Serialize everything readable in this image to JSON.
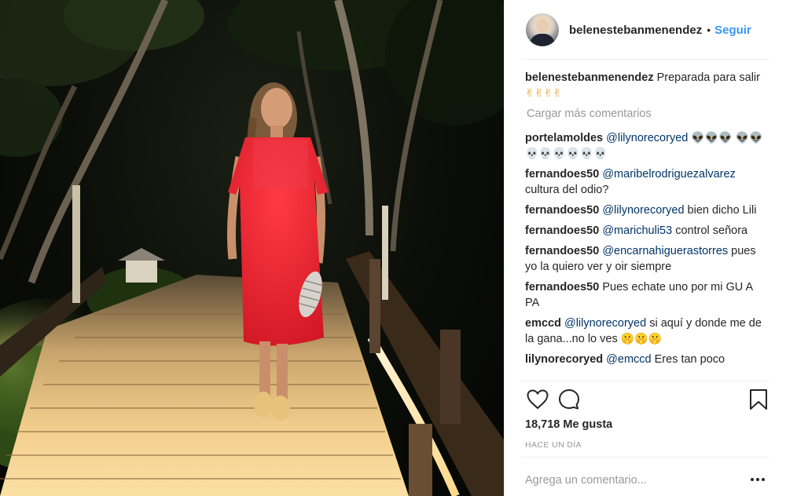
{
  "post": {
    "author": "belenestebanmenendez",
    "separator": "•",
    "follow_label": "Seguir",
    "photo_alt": "Mujer con vestido rojo sobre una pasarela de madera iluminada de noche"
  },
  "caption": {
    "user": "belenestebanmenendez",
    "text": "Preparada para salir",
    "emojis": "✌✌✌✌"
  },
  "load_more_label": "Cargar más comentarios",
  "comments": [
    {
      "user": "portelamoldes",
      "mention": "@lilynorecoryed",
      "text": "",
      "emojis_a": "👽👽👽",
      "emojis_b": "👽👽💀💀💀💀💀💀"
    },
    {
      "user": "fernandoes50",
      "mention": "@maribelrodriguezalvarez",
      "text": "cultura del odio?"
    },
    {
      "user": "fernandoes50",
      "mention": "@lilynorecoryed",
      "text": "bien dicho Lili"
    },
    {
      "user": "fernandoes50",
      "mention": "@marichuli53",
      "text": "control señora"
    },
    {
      "user": "fernandoes50",
      "mention": "@encarnahiguerastorres",
      "text": "pues yo la quiero ver y oir siempre"
    },
    {
      "user": "fernandoes50",
      "mention": "",
      "text": "Pues echate uno por mi GU A PA"
    },
    {
      "user": "emccd",
      "mention": "@lilynorecoryed",
      "text": "si aquí y donde me de la gana...no lo ves",
      "emojis": "🤫🤫🤫"
    },
    {
      "user": "lilynorecoryed",
      "mention": "@emccd",
      "text": "Eres tan poco"
    }
  ],
  "actions": {
    "like_icon": "heart-icon",
    "comment_icon": "speech-bubble-icon",
    "save_icon": "bookmark-icon"
  },
  "likes_text": "18,718 Me gusta",
  "timestamp": "HACE UN DÍA",
  "add_comment_placeholder": "Agrega un comentario...",
  "colors": {
    "link_blue": "#3897f0",
    "mention_blue": "#003569",
    "muted": "#999999",
    "dress": "#e8232f"
  }
}
